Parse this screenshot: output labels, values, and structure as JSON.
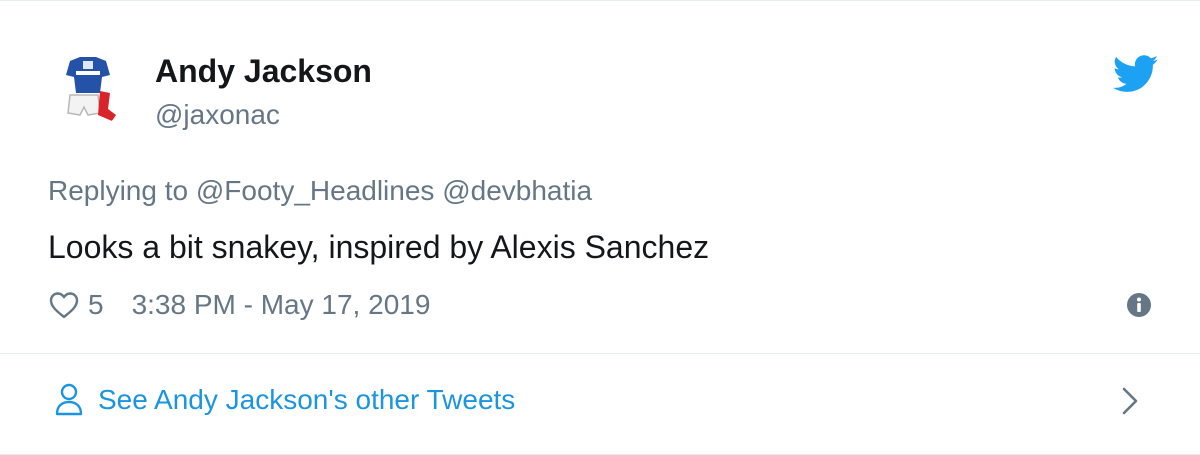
{
  "author": {
    "name": "Andy Jackson",
    "handle": "@jaxonac",
    "avatar_icon": "football-kit-avatar"
  },
  "tweet": {
    "replying_to_prefix": "Replying to",
    "replying_to_users": "@Footy_Headlines @devbhatia",
    "text": "Looks a bit snakey, inspired by Alexis Sanchez",
    "like_count": "5",
    "timestamp": "3:38 PM - May 17, 2019"
  },
  "footer": {
    "link_label": "See Andy Jackson's other Tweets"
  },
  "icons": {
    "brand": "twitter-bird-icon",
    "like": "heart-icon",
    "info": "info-icon",
    "profile": "person-icon",
    "next": "chevron-right-icon"
  },
  "colors": {
    "brand_blue": "#1da1f2",
    "link_blue": "#1b95e0",
    "text_primary": "#14171a",
    "text_secondary": "#657786",
    "border": "#e6ecf0"
  }
}
